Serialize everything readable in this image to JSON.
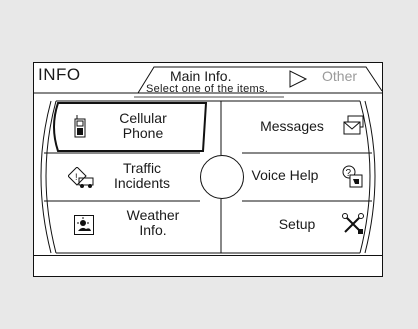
{
  "header": {
    "title": "INFO",
    "tabs": [
      {
        "label": "Main Info.",
        "active": true
      },
      {
        "label": "Other",
        "active": false
      }
    ],
    "subtitle": "Select one of the items."
  },
  "menu": {
    "left": [
      {
        "id": "cellular",
        "label_line1": "Cellular",
        "label_line2": "Phone",
        "icon": "phone-icon",
        "selected": true
      },
      {
        "id": "traffic",
        "label_line1": "Traffic",
        "label_line2": "Incidents",
        "icon": "traffic-incident-icon",
        "selected": false
      },
      {
        "id": "weather",
        "label_line1": "Weather",
        "label_line2": "Info.",
        "icon": "weather-icon",
        "selected": false
      }
    ],
    "right": [
      {
        "id": "messages",
        "label": "Messages",
        "icon": "envelope-icon"
      },
      {
        "id": "voice",
        "label": "Voice Help",
        "icon": "voice-help-icon"
      },
      {
        "id": "setup",
        "label": "Setup",
        "icon": "tools-icon"
      }
    ]
  },
  "colors": {
    "background": "#e8e8e8",
    "screen": "#ffffff",
    "line": "#111111",
    "inactive_tab": "#9a9a9a"
  }
}
